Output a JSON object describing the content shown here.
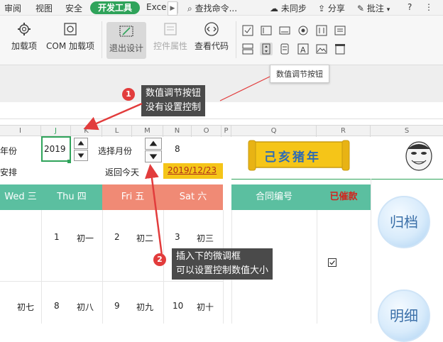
{
  "menubar": {
    "items": [
      "审阅",
      "视图",
      "安全"
    ],
    "active_tab": "开发工具",
    "overflow_tab": "Exce",
    "scroll_glyph": "▶",
    "search": "查找命令...",
    "sync": "未同步",
    "share": "分享",
    "comment": "批注",
    "help": "?"
  },
  "ribbon": {
    "addins": "加载项",
    "com_addins": "COM 加载项",
    "exit_design": "退出设计",
    "control_props": "控件属性",
    "view_code": "查看代码"
  },
  "columns": [
    "I",
    "J",
    "K",
    "L",
    "M",
    "N",
    "O",
    "P",
    "Q",
    "R",
    "S"
  ],
  "sheet": {
    "year_label_partial": "年份",
    "year_value": "2019",
    "month_label": "选择月份",
    "month_value": "8",
    "schedule_partial": "安排",
    "return_today": "返回今天",
    "today_date": "2019/12/23",
    "title_banner": "己亥猪年"
  },
  "calendar": {
    "headers": [
      {
        "label": "Wed 三",
        "color": "#5bbfa0"
      },
      {
        "label": "Thu 四",
        "color": "#5bbfa0"
      },
      {
        "label": "Fri 五",
        "color": "#f08a75"
      },
      {
        "label": "Sat 六",
        "color": "#f08a75"
      }
    ],
    "row1": [
      {
        "num": "1",
        "lunar": "初一"
      },
      {
        "num": "2",
        "lunar": "初二"
      },
      {
        "num": "3",
        "lunar": "初三"
      }
    ],
    "row2": [
      {
        "num": "",
        "lunar": "初七"
      },
      {
        "num": "8",
        "lunar": "初八"
      },
      {
        "num": "9",
        "lunar": "初九"
      },
      {
        "num": "10",
        "lunar": "初十"
      }
    ],
    "contract_header": "合同编号",
    "urged_header": "已催款"
  },
  "side": {
    "archive": "归档",
    "detail": "明细"
  },
  "annotations": {
    "tooltip": "数值调节按钮",
    "callout1_badge": "1",
    "callout1_line1": "数值调节按钮",
    "callout1_line2": "没有设置控制",
    "callout2_badge": "2",
    "callout2_line1": "插入下的微调框",
    "callout2_line2": "可以设置控制数值大小"
  },
  "colors": {
    "accent_green": "#2fa35a",
    "date_highlight": "#f5c518",
    "callout_bg": "#4a4a4a",
    "arrow_red": "#e23c3c"
  }
}
